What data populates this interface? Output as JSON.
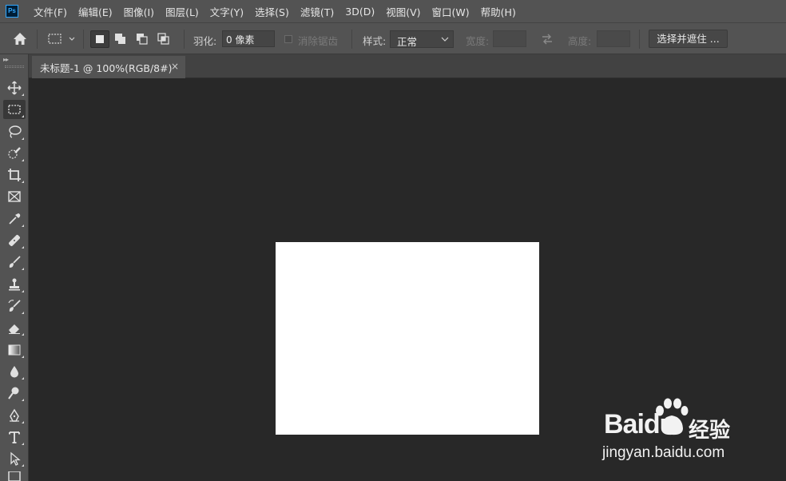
{
  "app": {
    "logo_text": "Ps"
  },
  "menu": [
    "文件(F)",
    "编辑(E)",
    "图像(I)",
    "图层(L)",
    "文字(Y)",
    "选择(S)",
    "滤镜(T)",
    "3D(D)",
    "视图(V)",
    "窗口(W)",
    "帮助(H)"
  ],
  "options": {
    "feather_label": "羽化:",
    "feather_value": "0 像素",
    "antialias_label": "消除锯齿",
    "style_label": "样式:",
    "style_value": "正常",
    "width_label": "宽度:",
    "height_label": "高度:",
    "select_mask_label": "选择并遮住 ..."
  },
  "document": {
    "tab_title": "未标题-1 @ 100%(RGB/8#)",
    "close_glyph": "×"
  },
  "watermark": {
    "brand": "Baidu",
    "cn": "经验",
    "url": "jingyan.baidu.com"
  },
  "colors": {
    "chrome": "#535353",
    "workspace": "#282828",
    "canvas": "#ffffff"
  }
}
